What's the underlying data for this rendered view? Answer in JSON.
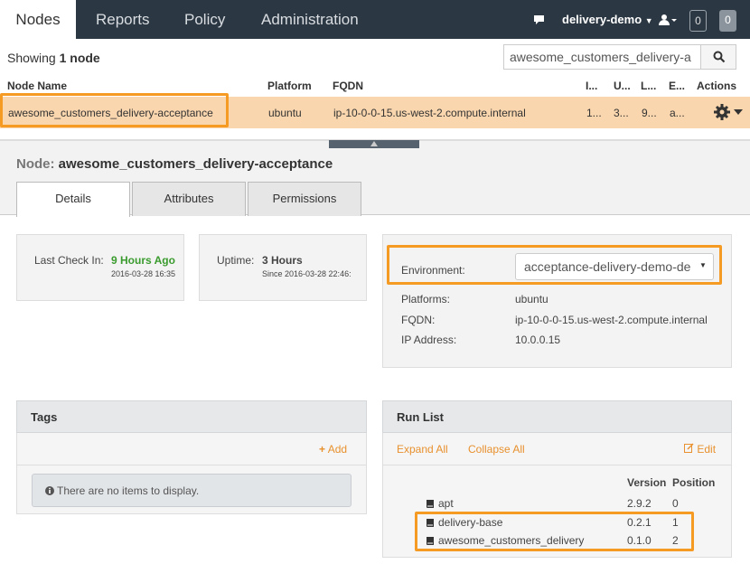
{
  "nav": {
    "tabs": [
      "Nodes",
      "Reports",
      "Policy",
      "Administration"
    ],
    "org": "delivery-demo",
    "counter_a": "0",
    "counter_b": "0"
  },
  "listing": {
    "showing_prefix": "Showing",
    "showing_count": "1 node",
    "search_value": "awesome_customers_delivery-a",
    "columns": [
      "Node Name",
      "Platform",
      "FQDN",
      "I...",
      "U...",
      "L...",
      "E...",
      "Actions"
    ],
    "row": {
      "name": "awesome_customers_delivery-acceptance",
      "platform": "ubuntu",
      "fqdn": "ip-10-0-0-15.us-west-2.compute.internal",
      "c1": "1...",
      "c2": "3...",
      "c3": "9...",
      "c4": "a..."
    }
  },
  "detail": {
    "title_label": "Node:",
    "title_value": "awesome_customers_delivery-acceptance",
    "tabs": [
      "Details",
      "Attributes",
      "Permissions"
    ],
    "checkin": {
      "label": "Last Check In:",
      "value": "9 Hours Ago",
      "date": "2016-03-28 16:35"
    },
    "uptime": {
      "label": "Uptime:",
      "value": "3 Hours",
      "since": "Since 2016-03-28 22:46:"
    },
    "environment": {
      "label": "Environment:",
      "value": "acceptance-delivery-demo-de"
    },
    "platforms": {
      "label": "Platforms:",
      "value": "ubuntu"
    },
    "fqdn": {
      "label": "FQDN:",
      "value": "ip-10-0-0-15.us-west-2.compute.internal"
    },
    "ip": {
      "label": "IP Address:",
      "value": "10.0.0.15"
    }
  },
  "tags": {
    "title": "Tags",
    "add_label": "Add",
    "empty_text": "There are no items to display."
  },
  "runlist": {
    "title": "Run List",
    "expand_all": "Expand All",
    "collapse_all": "Collapse All",
    "edit_label": "Edit",
    "col_version": "Version",
    "col_position": "Position",
    "items": [
      {
        "name": "apt",
        "version": "2.9.2",
        "position": "0"
      },
      {
        "name": "delivery-base",
        "version": "0.2.1",
        "position": "1"
      },
      {
        "name": "awesome_customers_delivery",
        "version": "0.1.0",
        "position": "2"
      }
    ]
  },
  "colors": {
    "topbar": "#2b3743",
    "highlight": "#f59a23",
    "selected_row": "#fad6ae",
    "green": "#3a9b2e",
    "link": "#e8912e"
  }
}
